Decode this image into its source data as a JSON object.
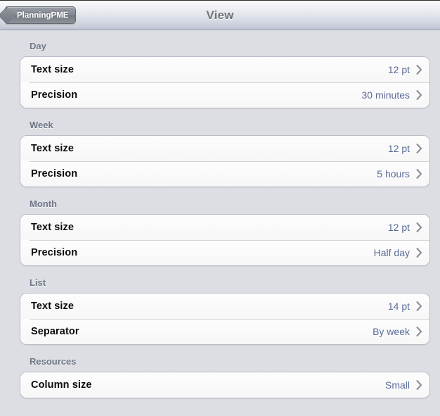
{
  "navbar": {
    "back_label": "PlanningPME",
    "title": "View"
  },
  "colors": {
    "background": "#dcdee3",
    "row_background": "#fdfdfd",
    "value_text": "#5b6b97",
    "section_header_text": "#6d7585",
    "label_text": "#0b0b0b",
    "chevron": "#8d9199",
    "navbar_title": "#70747c"
  },
  "sections": [
    {
      "header": "Day",
      "rows": [
        {
          "label": "Text size",
          "value": "12 pt",
          "accessory": "chevron-right-icon"
        },
        {
          "label": "Precision",
          "value": "30 minutes",
          "accessory": "chevron-right-icon"
        }
      ]
    },
    {
      "header": "Week",
      "rows": [
        {
          "label": "Text size",
          "value": "12 pt",
          "accessory": "chevron-right-icon"
        },
        {
          "label": "Precision",
          "value": "5 hours",
          "accessory": "chevron-right-icon"
        }
      ]
    },
    {
      "header": "Month",
      "rows": [
        {
          "label": "Text size",
          "value": "12 pt",
          "accessory": "chevron-right-icon"
        },
        {
          "label": "Precision",
          "value": "Half day",
          "accessory": "chevron-right-icon"
        }
      ]
    },
    {
      "header": "List",
      "rows": [
        {
          "label": "Text size",
          "value": "14 pt",
          "accessory": "chevron-right-icon"
        },
        {
          "label": "Separator",
          "value": "By week",
          "accessory": "chevron-right-icon"
        }
      ]
    },
    {
      "header": "Resources",
      "rows": [
        {
          "label": "Column size",
          "value": "Small",
          "accessory": "chevron-right-icon"
        }
      ]
    }
  ]
}
